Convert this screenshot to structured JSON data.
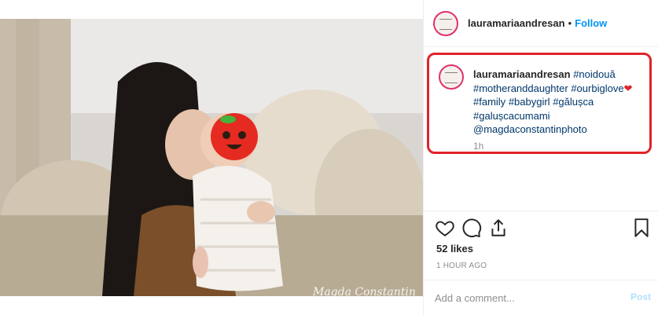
{
  "post": {
    "username": "lauramariaandresan",
    "follow_label": "Follow",
    "header_separator": "•",
    "watermark": "Magda Constantin"
  },
  "caption": {
    "username": "lauramariaandresan",
    "tags": [
      "#noidouă",
      "#motheranddaughter",
      "#ourbiglove",
      "#family",
      "#babygirl",
      "#gălușca",
      "#galușcacumami",
      "@magdaconstantinphoto"
    ],
    "time": "1h"
  },
  "engagement": {
    "likes": "52 likes",
    "timestamp": "1 HOUR AGO"
  },
  "comment": {
    "placeholder": "Add a comment...",
    "post_label": "Post"
  },
  "colors": {
    "accent": "#0095f6",
    "highlight_border": "#e0242a",
    "tag": "#00376b"
  }
}
